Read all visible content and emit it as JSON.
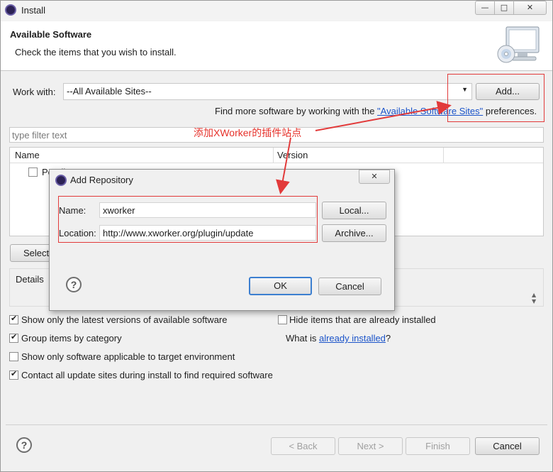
{
  "window": {
    "title": "Install",
    "minimize_glyph": "—",
    "maximize_glyph": "□",
    "close_glyph": "✕"
  },
  "header": {
    "title": "Available Software",
    "subtitle": "Check the items that you wish to install."
  },
  "work_with": {
    "label": "Work with:",
    "selected": "--All Available Sites--",
    "add_button": "Add...",
    "find_more_prefix": "Find more software by working with the ",
    "find_more_link": "\"Available Software Sites\"",
    "find_more_suffix": " preferences."
  },
  "filter": {
    "placeholder": "type filter text"
  },
  "table": {
    "columns": [
      "Name",
      "Version"
    ],
    "rows": [
      {
        "name": "Pending..."
      }
    ]
  },
  "select_all_button": "Select All",
  "details": {
    "label": "Details"
  },
  "options": {
    "show_latest": {
      "label": "Show only the latest versions of available software",
      "checked": true
    },
    "group_by_category": {
      "label": "Group items by category",
      "checked": true
    },
    "show_applicable": {
      "label": "Show only software applicable to target environment",
      "checked": false
    },
    "contact_all": {
      "label": "Contact all update sites during install to find required software",
      "checked": true
    },
    "hide_installed": {
      "label": "Hide items that are already installed",
      "checked": false
    },
    "what_is_prefix": "What is ",
    "what_is_link": "already installed",
    "what_is_suffix": "?"
  },
  "footer": {
    "back": "< Back",
    "next": "Next >",
    "finish": "Finish",
    "cancel": "Cancel",
    "help_glyph": "?"
  },
  "dialog": {
    "title": "Add Repository",
    "name_label": "Name:",
    "name_value": "xworker",
    "location_label": "Location:",
    "location_value": "http://www.xworker.org/plugin/update",
    "local_button": "Local...",
    "archive_button": "Archive...",
    "ok_button": "OK",
    "cancel_button": "Cancel",
    "help_glyph": "?"
  },
  "annotation": {
    "text": "添加XWorker的插件站点",
    "color": "#e6322b"
  },
  "colors": {
    "link": "#1a53c9",
    "annotation_red": "#e23a3a"
  }
}
